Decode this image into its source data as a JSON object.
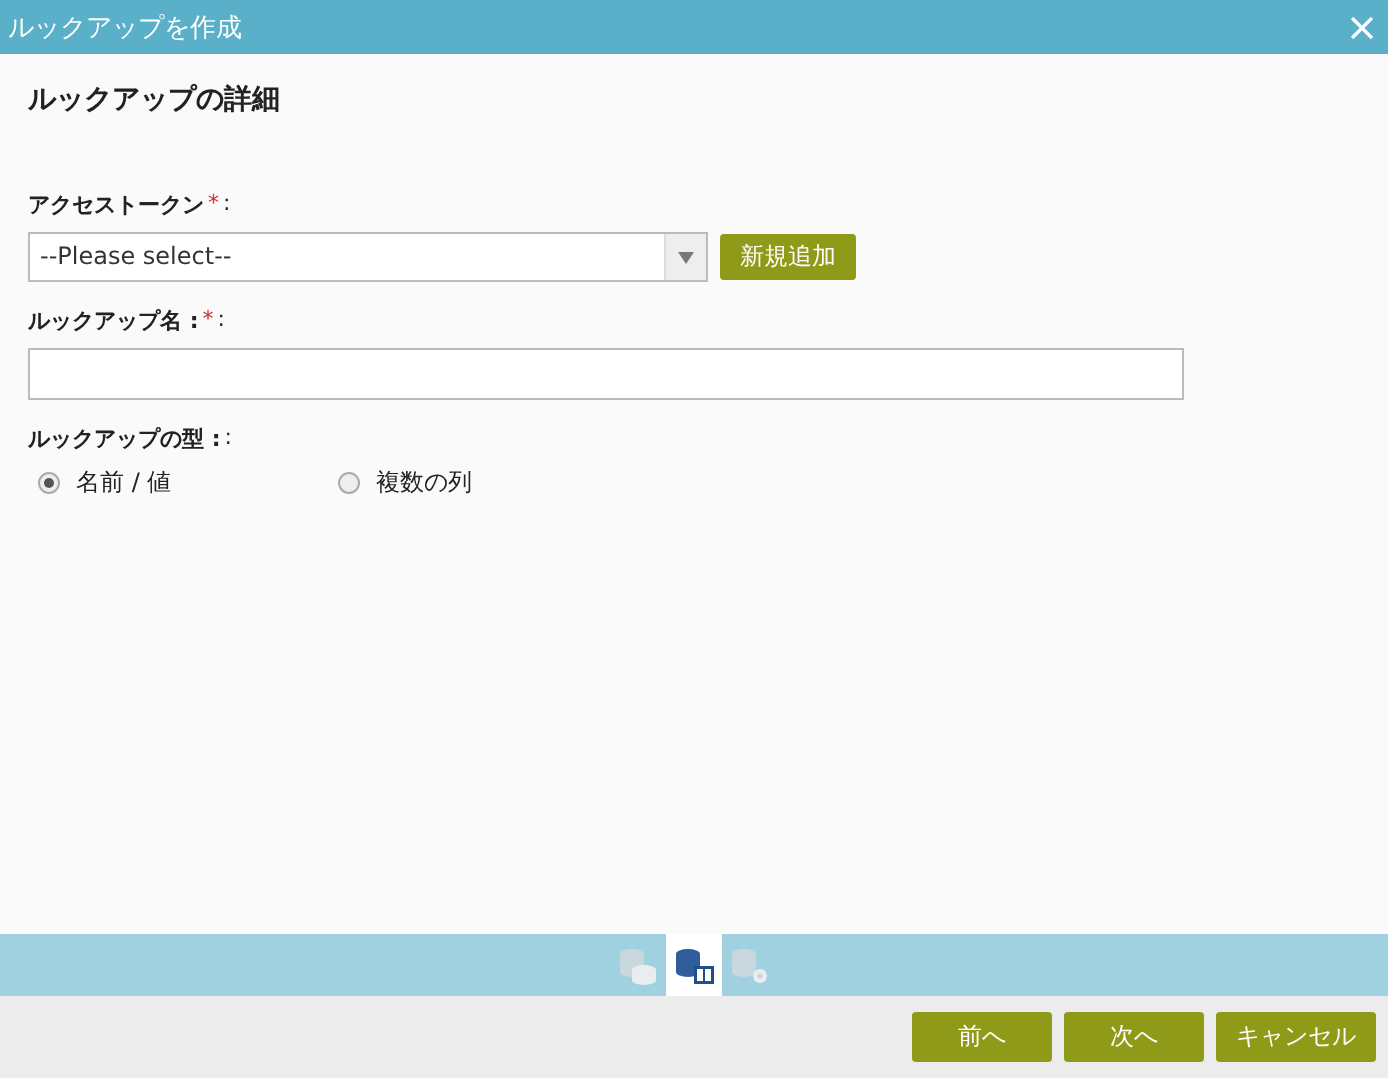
{
  "window": {
    "title": "ルックアップを作成"
  },
  "section_title": "ルックアップの詳細",
  "fields": [
    {
      "kind": "select",
      "label": "アクセストークン",
      "required_mark": "*",
      "suffix": ":",
      "value": "--Please select--",
      "button": "新規追加"
    },
    {
      "kind": "text",
      "label": "ルックアップ名 :",
      "required_mark": "*",
      "suffix": ":"
    },
    {
      "kind": "radio",
      "label": "ルックアップの型 :",
      "suffix": ":",
      "options": [
        {
          "label": "名前 / 値",
          "selected": true
        },
        {
          "label": "複数の列",
          "selected": false
        }
      ]
    }
  ],
  "steps": [
    {
      "selected": false
    },
    {
      "selected": true
    },
    {
      "selected": false
    }
  ],
  "buttons": [
    "前へ",
    "次へ",
    "キャンセル"
  ]
}
